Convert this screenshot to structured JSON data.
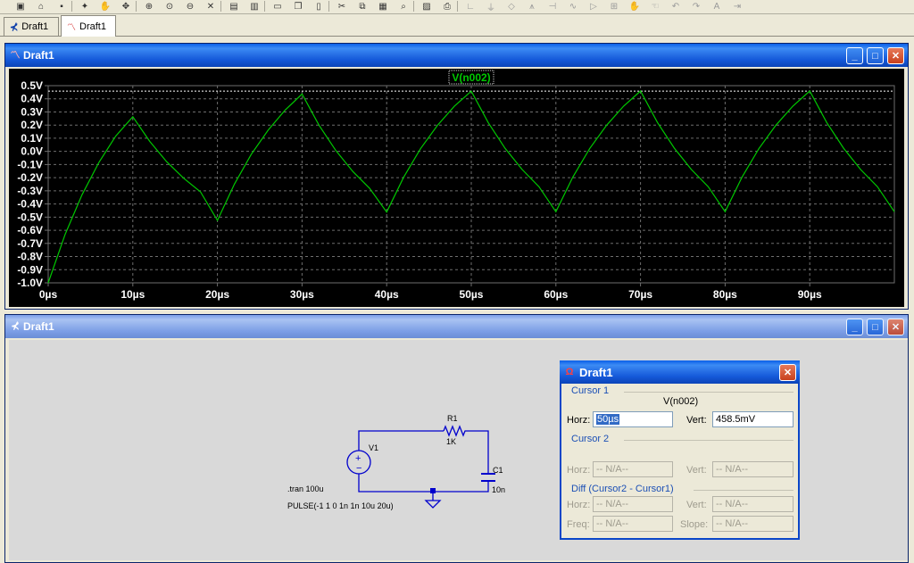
{
  "toolbar": {
    "icons": [
      "new-schematic-icon",
      "open-icon",
      "save-icon",
      "run-icon",
      "halt-icon",
      "pan-icon",
      "zoom-in-icon",
      "zoom-area-icon",
      "zoom-out-icon",
      "zoom-cancel-icon",
      "autorange-icon",
      "autorange-x-icon",
      "tile-horizontal-icon",
      "cascade-icon",
      "tile-vertical-icon",
      "cut-icon",
      "copy-icon",
      "paste-icon",
      "find-icon",
      "print-preview-icon",
      "print-icon",
      "wire-icon",
      "ground-icon",
      "label-icon",
      "resistor-icon",
      "capacitor-icon",
      "inductor-icon",
      "diode-icon",
      "component-icon",
      "move-icon",
      "drag-icon",
      "undo-icon",
      "redo-icon",
      "text-icon",
      "spice-directive-icon"
    ]
  },
  "doc_tabs": [
    {
      "label": "Draft1",
      "icon": "schematic-icon",
      "active": false
    },
    {
      "label": "Draft1",
      "icon": "waveform-icon",
      "active": true
    }
  ],
  "plot_window": {
    "title": "Draft1",
    "trace_label": "V(n002)",
    "colors": {
      "background": "#000000",
      "trace": "#00c800",
      "grid": "#6e6e6e",
      "text": "#ffffff"
    }
  },
  "chart_data": {
    "type": "line",
    "title": "",
    "series": [
      {
        "name": "V(n002)",
        "x_us": [
          0,
          2,
          4,
          6,
          8,
          10,
          12,
          14,
          16,
          18,
          20,
          22,
          24,
          26,
          28,
          30,
          32,
          34,
          36,
          38,
          40,
          42,
          44,
          46,
          48,
          50,
          52,
          54,
          56,
          58,
          60,
          62,
          64,
          66,
          68,
          70,
          72,
          74,
          76,
          78,
          80,
          82,
          84,
          86,
          88,
          90,
          92,
          94,
          96,
          98,
          100
        ],
        "y_v": [
          -1.0,
          -0.631,
          -0.33,
          -0.083,
          0.118,
          0.264,
          0.076,
          -0.078,
          -0.204,
          -0.308,
          -0.525,
          -0.249,
          -0.022,
          0.162,
          0.314,
          0.436,
          0.199,
          0.006,
          -0.153,
          -0.282,
          -0.462,
          -0.197,
          0.02,
          0.198,
          0.343,
          0.458,
          0.219,
          0.023,
          -0.137,
          -0.268,
          -0.459,
          -0.195,
          0.022,
          0.199,
          0.344,
          0.459,
          0.22,
          0.024,
          -0.137,
          -0.268,
          -0.459,
          -0.195,
          0.022,
          0.199,
          0.344,
          0.459,
          0.22,
          0.024,
          -0.137,
          -0.268,
          -0.459
        ]
      }
    ],
    "xlim": [
      0,
      100
    ],
    "ylim": [
      -1.0,
      0.5
    ],
    "x_ticks": [
      0,
      10,
      20,
      30,
      40,
      50,
      60,
      70,
      80,
      90
    ],
    "x_tick_labels": [
      "0µs",
      "10µs",
      "20µs",
      "30µs",
      "40µs",
      "50µs",
      "60µs",
      "70µs",
      "80µs",
      "90µs"
    ],
    "y_ticks": [
      0.5,
      0.4,
      0.3,
      0.2,
      0.1,
      0.0,
      -0.1,
      -0.2,
      -0.3,
      -0.4,
      -0.5,
      -0.6,
      -0.7,
      -0.8,
      -0.9,
      -1.0
    ],
    "y_tick_labels": [
      "0.5V",
      "0.4V",
      "0.3V",
      "0.2V",
      "0.1V",
      "0.0V",
      "-0.1V",
      "-0.2V",
      "-0.3V",
      "-0.4V",
      "-0.5V",
      "-0.6V",
      "-0.7V",
      "-0.8V",
      "-0.9V",
      "-1.0V"
    ],
    "cursor_level_v": 0.4585,
    "grid": true
  },
  "schematic_window": {
    "title": "Draft1",
    "colors": {
      "background": "#d9d9d9",
      "wire": "#0000cd",
      "text": "#000000"
    },
    "components": {
      "source_name": "V1",
      "resistor_name": "R1",
      "resistor_value": "1K",
      "capacitor_name": "C1",
      "capacitor_value": "10n"
    },
    "directives": {
      "tran": ".tran 100u",
      "pulse": "PULSE(-1 1 0 1n 1n 10u 20u)"
    }
  },
  "cursor_dialog": {
    "title": "Draft1",
    "cursor1": {
      "label": "Cursor 1",
      "trace": "V(n002)",
      "horz_label": "Horz:",
      "horz_value": "50µs",
      "vert_label": "Vert:",
      "vert_value": "458.5mV"
    },
    "cursor2": {
      "label": "Cursor 2",
      "horz_label": "Horz:",
      "horz_value": "-- N/A--",
      "vert_label": "Vert:",
      "vert_value": "-- N/A--"
    },
    "diff": {
      "label": "Diff (Cursor2 - Cursor1)",
      "horz_label": "Horz:",
      "horz_value": "-- N/A--",
      "vert_label": "Vert:",
      "vert_value": "-- N/A--",
      "freq_label": "Freq:",
      "freq_value": "-- N/A--",
      "slope_label": "Slope:",
      "slope_value": "-- N/A--"
    }
  }
}
